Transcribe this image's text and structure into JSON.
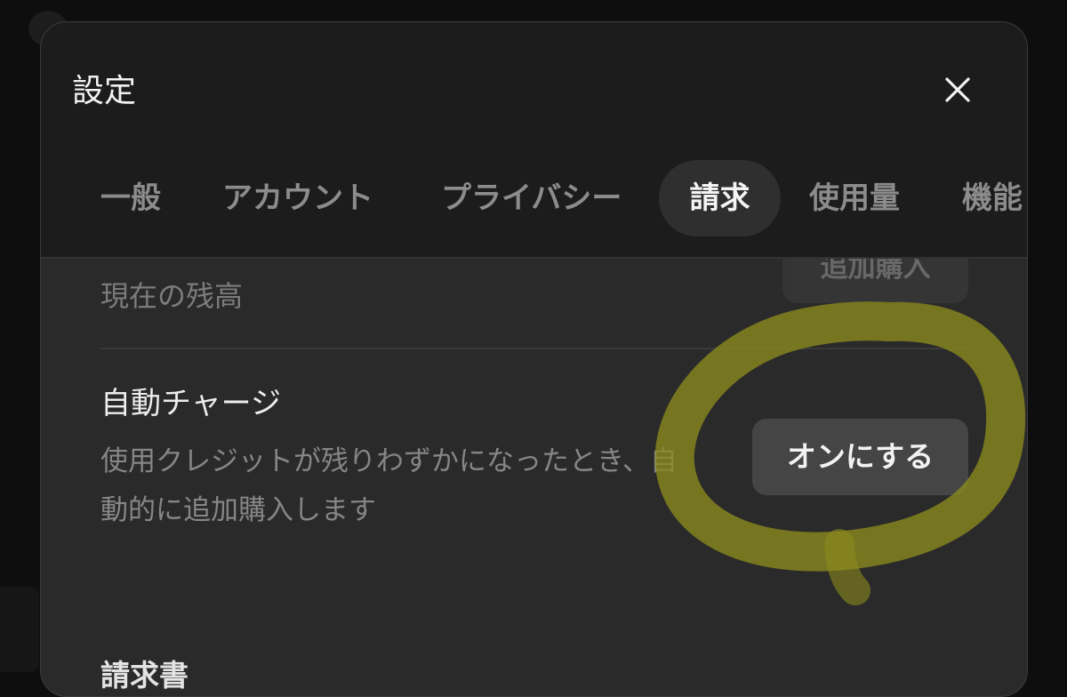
{
  "dialog": {
    "title": "設定",
    "close_icon": "close-icon"
  },
  "tabs": [
    {
      "label": "一般",
      "active": false
    },
    {
      "label": "アカウント",
      "active": false
    },
    {
      "label": "プライバシー",
      "active": false
    },
    {
      "label": "請求",
      "active": true
    },
    {
      "label": "使用量",
      "active": false
    },
    {
      "label": "機能",
      "active": false
    }
  ],
  "billing": {
    "purchase_button_label": "追加購入",
    "balance_label": "現在の残高",
    "auto_charge": {
      "title": "自動チャージ",
      "description": "使用クレジットが残りわずかになったとき、自動的に追加購入します",
      "button_label": "オンにする"
    },
    "next_section_heading": "請求書"
  },
  "colors": {
    "highlight": "#8c8a1e",
    "modal_background": "#2a2a2a",
    "header_background": "#1c1c1c"
  }
}
